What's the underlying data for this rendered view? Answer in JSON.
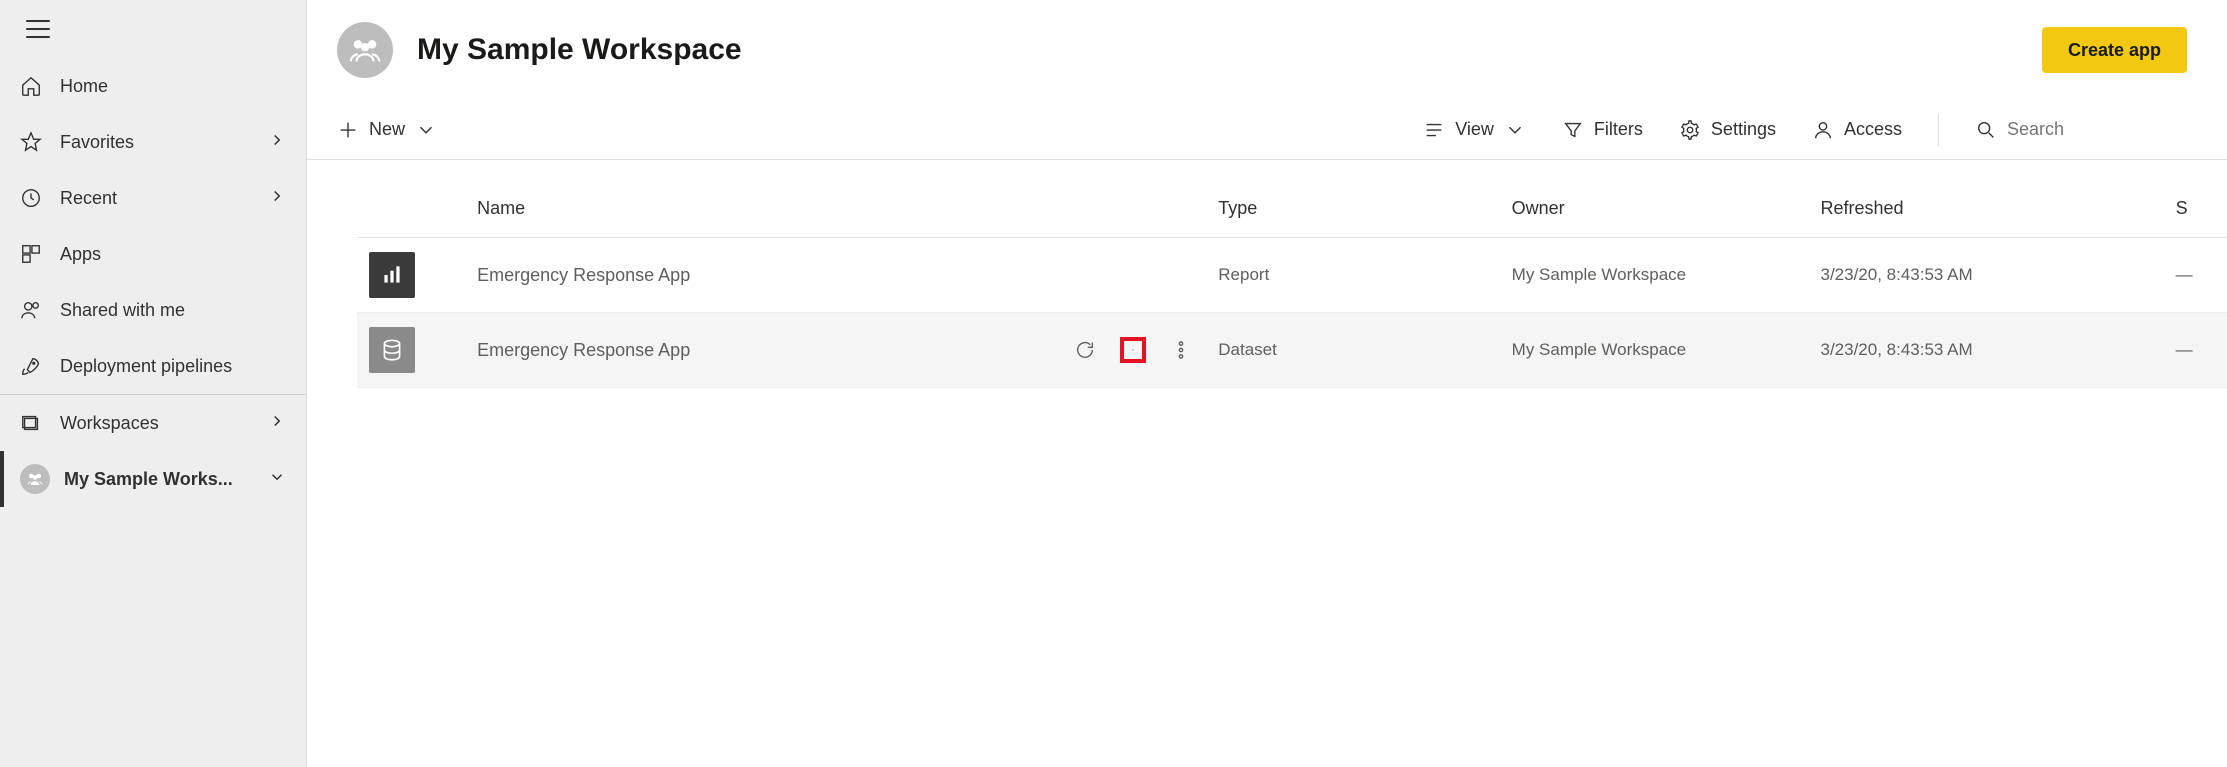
{
  "sidebar": {
    "items": [
      {
        "id": "home",
        "label": "Home"
      },
      {
        "id": "favorites",
        "label": "Favorites"
      },
      {
        "id": "recent",
        "label": "Recent"
      },
      {
        "id": "apps",
        "label": "Apps"
      },
      {
        "id": "shared",
        "label": "Shared with me"
      },
      {
        "id": "pipelines",
        "label": "Deployment pipelines"
      }
    ],
    "workspaces_label": "Workspaces",
    "current_workspace": "My Sample Works..."
  },
  "header": {
    "title": "My Sample Workspace",
    "create_app": "Create app"
  },
  "toolbar": {
    "new": "New",
    "view": "View",
    "filters": "Filters",
    "settings": "Settings",
    "access": "Access",
    "search_placeholder": "Search"
  },
  "table": {
    "columns": {
      "name": "Name",
      "type": "Type",
      "owner": "Owner",
      "refreshed": "Refreshed",
      "last": "S"
    },
    "rows": [
      {
        "name": "Emergency Response App",
        "type": "Report",
        "owner": "My Sample Workspace",
        "refreshed": "3/23/20, 8:43:53 AM",
        "last": "—"
      },
      {
        "name": "Emergency Response App",
        "type": "Dataset",
        "owner": "My Sample Workspace",
        "refreshed": "3/23/20, 8:43:53 AM",
        "last": "—"
      }
    ]
  }
}
